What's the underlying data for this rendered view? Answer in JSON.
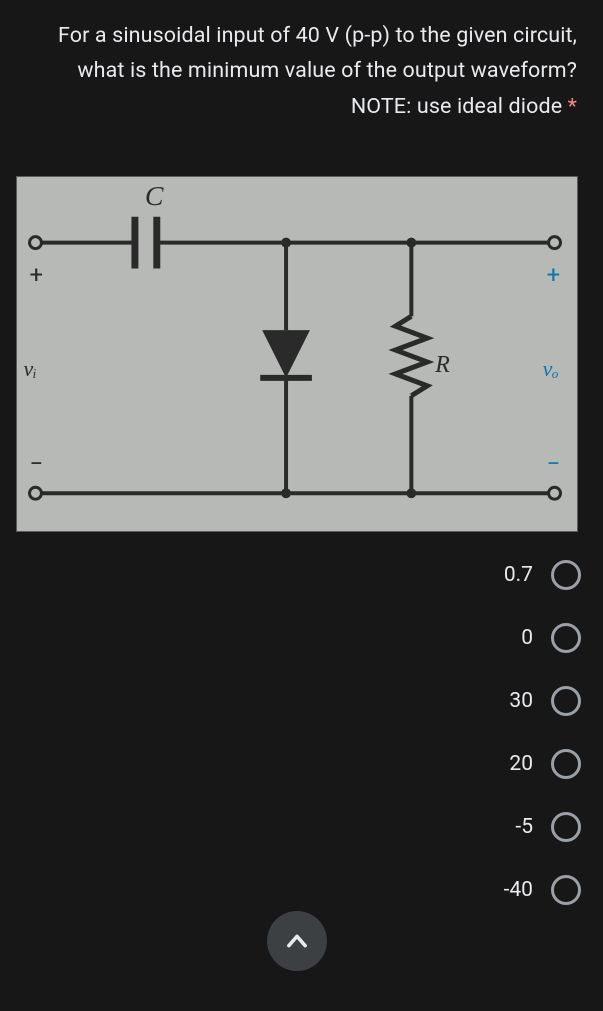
{
  "question": {
    "text": "For a sinusoidal input of 40 V (p-p) to the given circuit, what is the minimum value of the output waveform? NOTE: use ideal diode",
    "required_marker": "*"
  },
  "circuit": {
    "labels": {
      "capacitor": "C",
      "resistor": "R",
      "vin": "vᵢ",
      "vout": "vₒ",
      "plus_left": "+",
      "plus_right": "+",
      "minus_left": "−",
      "minus_right": "−"
    }
  },
  "options": [
    {
      "label": "0.7"
    },
    {
      "label": "0"
    },
    {
      "label": "30"
    },
    {
      "label": "20"
    },
    {
      "label": "-5"
    },
    {
      "label": "-40"
    }
  ],
  "icons": {
    "scroll_top": "chevron-up"
  }
}
